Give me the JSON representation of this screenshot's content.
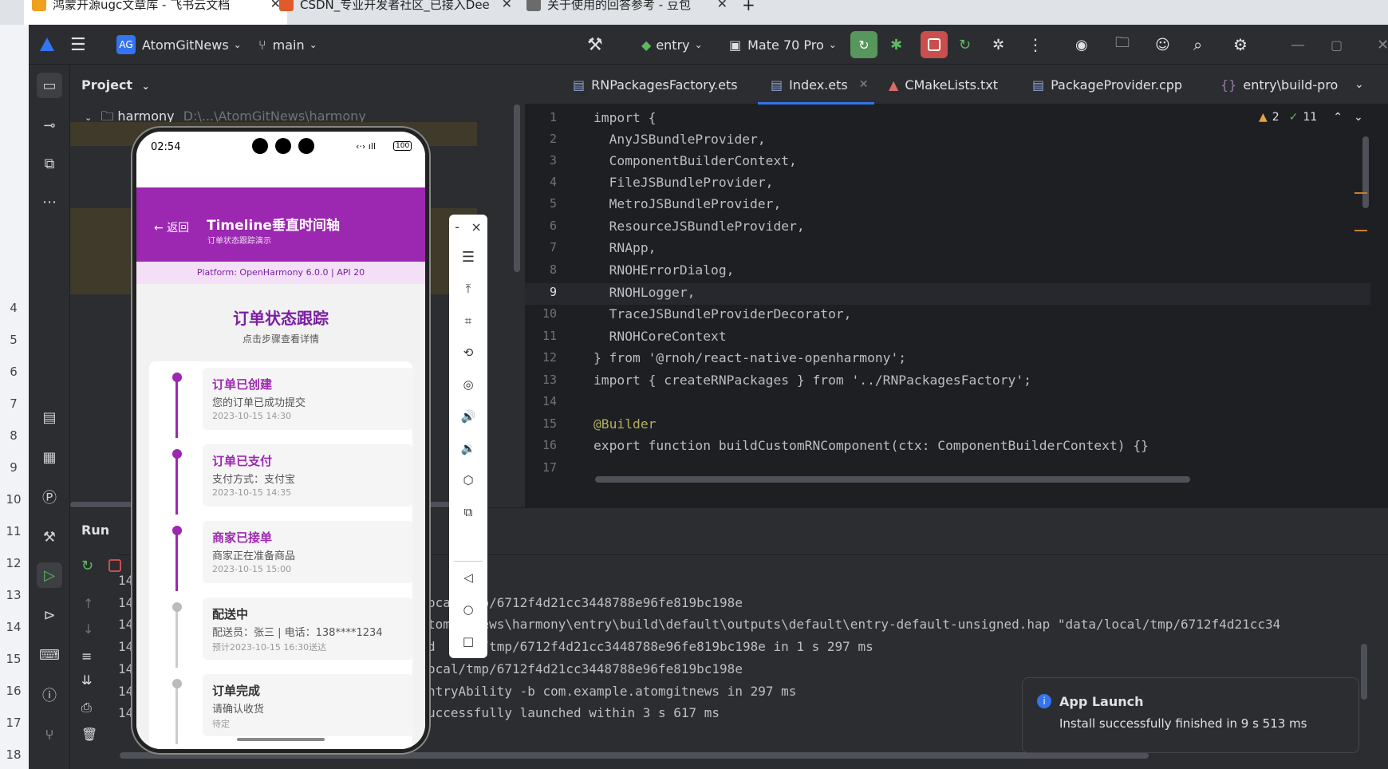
{
  "browser": {
    "tabs": [
      {
        "title": "鸿蒙开源ugc文章库 - 飞书云文档",
        "color": "#f0a020"
      },
      {
        "title": "CSDN_专业开发者社区_已接入Dee",
        "color": "#e05a2a"
      },
      {
        "title": "关于使用的回答参考 - 豆包",
        "color": "#6b6b6b"
      }
    ],
    "new_tab": "+"
  },
  "ide": {
    "project_badge": "AG",
    "project_name": "AtomGitNews",
    "branch": "main",
    "run_config": "entry",
    "device": "Mate 70 Pro",
    "project_panel_title": "Project",
    "tree_root": "harmony",
    "tree_root_path": "D:\\...\\AtomGitNews\\harmony",
    "editor_tabs": [
      {
        "label": "RNPackagesFactory.ets",
        "active": false
      },
      {
        "label": "Index.ets",
        "active": true
      },
      {
        "label": "CMakeLists.txt",
        "active": false
      },
      {
        "label": "PackageProvider.cpp",
        "active": false
      },
      {
        "label": "entry\\build-pro",
        "active": false
      }
    ],
    "inspections": {
      "warnings": "2",
      "ok": "11"
    },
    "code_lines": [
      {
        "n": "1",
        "text": "import {"
      },
      {
        "n": "2",
        "text": "  AnyJSBundleProvider,"
      },
      {
        "n": "3",
        "text": "  ComponentBuilderContext,"
      },
      {
        "n": "4",
        "text": "  FileJSBundleProvider,"
      },
      {
        "n": "5",
        "text": "  MetroJSBundleProvider,"
      },
      {
        "n": "6",
        "text": "  ResourceJSBundleProvider,"
      },
      {
        "n": "7",
        "text": "  RNApp,"
      },
      {
        "n": "8",
        "text": "  RNOHErrorDialog,"
      },
      {
        "n": "9",
        "text": "  RNOHLogger,"
      },
      {
        "n": "10",
        "text": "  TraceJSBundleProviderDecorator,"
      },
      {
        "n": "11",
        "text": "  RNOHCoreContext"
      },
      {
        "n": "12",
        "text": "} from '@rnoh/react-native-openharmony';"
      },
      {
        "n": "13",
        "text": "import { createRNPackages } from '../RNPackagesFactory';"
      },
      {
        "n": "14",
        "text": ""
      },
      {
        "n": "15",
        "text": "@Builder"
      },
      {
        "n": "16",
        "text": "export function buildCustomRNComponent(ctx: ComponentBuilderContext) {}"
      },
      {
        "n": "17",
        "text": ""
      }
    ],
    "run_title": "Run",
    "log_lines": [
      {
        "n": "14",
        "text": "ocal/tmp/6712f4d21cc3448788e96fe819bc198e"
      },
      {
        "n": "14",
        "text": "tomGitNews\\harmony\\entry\\build\\default\\outputs\\default\\entry-default-unsigned.hap \"data/local/tmp/6712f4d21cc34"
      },
      {
        "n": "14",
        "text": "d  ocal/tmp/6712f4d21cc3448788e96fe819bc198e in 1 s 297 ms"
      },
      {
        "n": "14",
        "text": "ocal/tmp/6712f4d21cc3448788e96fe819bc198e"
      },
      {
        "n": "14",
        "text": "ntryAbility -b com.example.atomgitnews in 297 ms"
      },
      {
        "n": "14",
        "text": "uccessfully launched within 3 s 617 ms"
      }
    ],
    "log_prefix": "14",
    "gutter_numbers": [
      "4",
      "5",
      "6",
      "7",
      "8",
      "9",
      "10",
      "11",
      "12",
      "13",
      "14",
      "15",
      "16",
      "17",
      "18"
    ],
    "notification": {
      "title": "App Launch",
      "body": "Install successfully finished in 9 s 513 ms"
    }
  },
  "phone": {
    "time": "02:54",
    "battery": "100",
    "back_label": "← 返回",
    "header_title": "Timeline垂直时间轴",
    "header_subtitle": "订单状态跟踪演示",
    "platform": "Platform: OpenHarmony 6.0.0 | API 20",
    "section_title": "订单状态跟踪",
    "section_hint": "点击步骤查看详情",
    "steps": [
      {
        "title": "订单已创建",
        "desc": "您的订单已成功提交",
        "time": "2023-10-15 14:30",
        "done": true
      },
      {
        "title": "订单已支付",
        "desc": "支付方式：支付宝",
        "time": "2023-10-15 14:35",
        "done": true
      },
      {
        "title": "商家已接单",
        "desc": "商家正在准备商品",
        "time": "2023-10-15 15:00",
        "done": true
      },
      {
        "title": "配送中",
        "desc": "配送员：张三 | 电话：138****1234",
        "time": "预计2023-10-15 16:30送达",
        "done": false
      },
      {
        "title": "订单完成",
        "desc": "请确认收货",
        "time": "待定",
        "done": false
      }
    ],
    "accent": "#9c27b0"
  },
  "emulator_tools": {
    "minimize": "-",
    "close": "×"
  }
}
